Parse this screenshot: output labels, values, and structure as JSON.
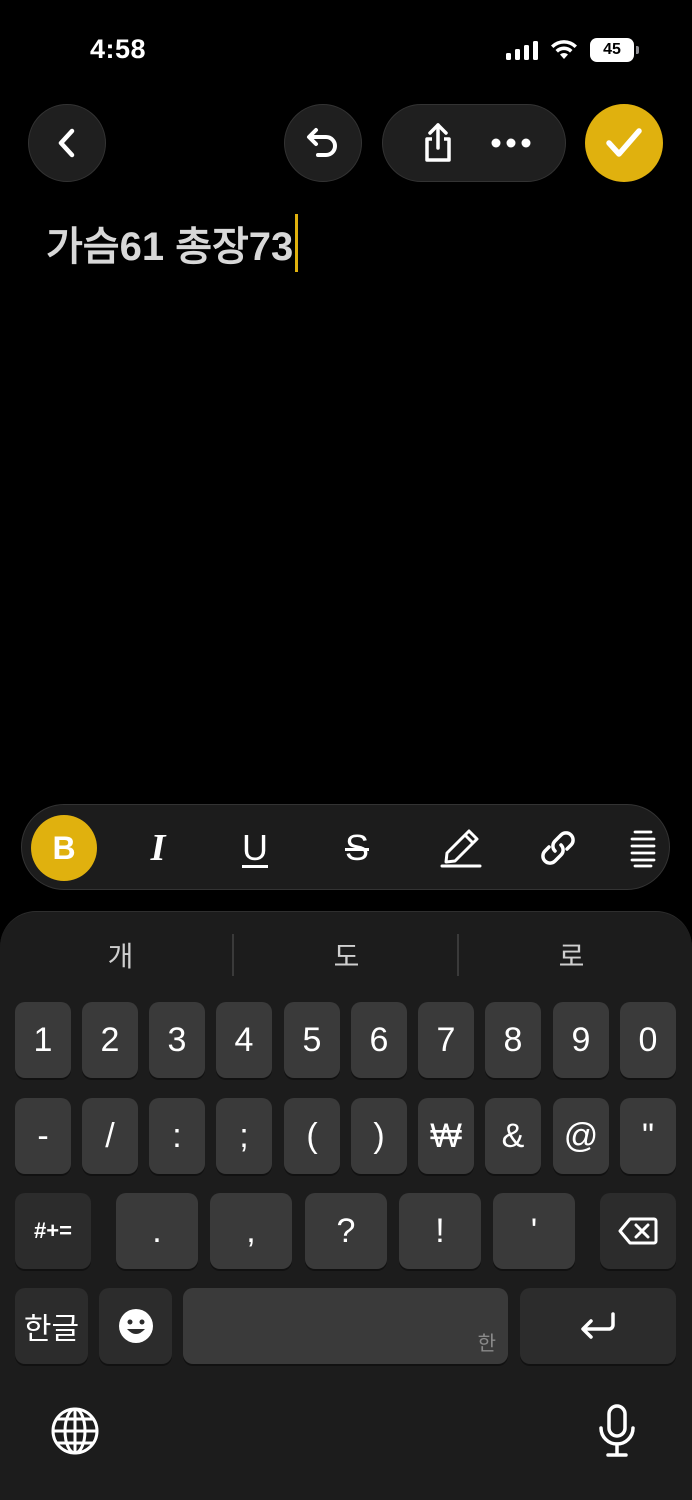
{
  "status_bar": {
    "time": "4:58",
    "battery": "45"
  },
  "toolbar": {
    "back_icon": "chevron-left-icon",
    "undo_icon": "undo-icon",
    "share_icon": "share-icon",
    "more_icon": "ellipsis-icon",
    "done_icon": "checkmark-icon",
    "accent_color": "#e0b10e"
  },
  "note": {
    "text": "가슴61 총장73"
  },
  "format_bar": {
    "bold_label": "B",
    "italic_label": "I",
    "underline_label": "U",
    "strike_label": "S",
    "items": [
      "bold",
      "italic",
      "underline",
      "strikethrough",
      "highlighter-icon",
      "link-icon",
      "list-icon"
    ]
  },
  "keyboard": {
    "suggestions": [
      "개",
      "도",
      "로"
    ],
    "row1": [
      "1",
      "2",
      "3",
      "4",
      "5",
      "6",
      "7",
      "8",
      "9",
      "0"
    ],
    "row2": [
      "-",
      "/",
      ":",
      ";",
      "(",
      ")",
      "₩",
      "&",
      "@",
      "\""
    ],
    "row3_mode": "#+=",
    "row3": [
      ".",
      ",",
      "?",
      "!",
      "'"
    ],
    "lang_key": "한글",
    "space_hint": "한",
    "emoji_icon": "emoji-icon",
    "delete_icon": "delete-icon",
    "return_icon": "return-icon",
    "globe_icon": "globe-icon",
    "mic_icon": "microphone-icon"
  }
}
